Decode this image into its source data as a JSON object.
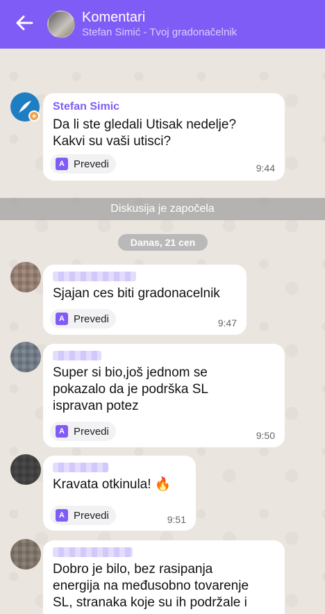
{
  "header": {
    "title": "Komentari",
    "subtitle": "Stefan Simić - Tvoj gradonačelnik"
  },
  "pinned": {
    "sender": "Stefan Simic",
    "text_line1": "Da li ste gledali Utisak nedelje?",
    "text_line2": "Kakvi su vaši utisci?",
    "translate_label": "Prevedi",
    "time": "9:44"
  },
  "divider": "Diskusija je započela",
  "date_chip": "Danas, 21 cen",
  "comments": [
    {
      "lines": [
        "Sjajan ces biti gradonacelnik"
      ],
      "translate_label": "Prevedi",
      "time": "9:47"
    },
    {
      "lines": [
        "Super si bio,još jednom se",
        "pokazalo da je podrška SL",
        "ispravan potez"
      ],
      "translate_label": "Prevedi",
      "time": "9:50"
    },
    {
      "lines": [
        "Kravata otkinula! 🔥"
      ],
      "translate_label": "Prevedi",
      "time": "9:51"
    },
    {
      "lines": [
        "Dobro je bilo, bez rasipanja",
        "energija na međusobno tovarenje",
        "SL, stranaka koje su ih podržale i"
      ]
    }
  ],
  "colors": {
    "accent": "#7f5cf6",
    "background": "#ebe5df"
  }
}
